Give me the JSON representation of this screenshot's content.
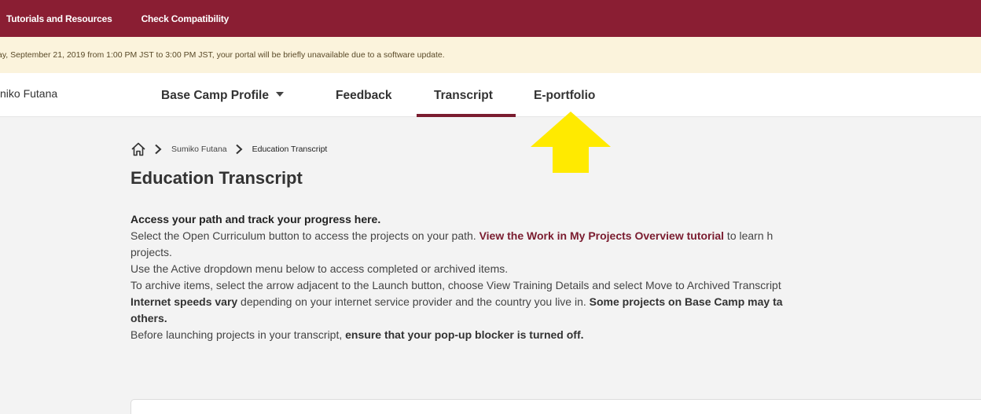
{
  "topbar": {
    "links": [
      "Tutorials and Resources",
      "Check Compatibility"
    ],
    "bg_color": "#8a1e33"
  },
  "banner": {
    "text": "ay, September 21, 2019 from 1:00 PM JST to 3:00 PM JST, your portal will be briefly unavailable due to a software update."
  },
  "navbar": {
    "username": "niko Futana",
    "tabs": [
      "Base Camp Profile",
      "Feedback",
      "Transcript",
      "E-portfolio"
    ],
    "active_tab": "Transcript"
  },
  "annotation": {
    "arrow_color": "#ffea00",
    "arrow_direction": "up"
  },
  "breadcrumb": {
    "items": [
      "Sumiko Futana",
      "Education Transcript"
    ]
  },
  "page": {
    "title": "Education Transcript"
  },
  "content": {
    "lead": "Access your path and track your progress here.",
    "line1_pre": "Select the Open Curriculum button to access the projects on your path. ",
    "line1_link": "View the Work in My Projects Overview tutorial",
    "line1_post": " to learn h",
    "line1_wrap": "projects.",
    "line2": "Use the Active dropdown menu below to access completed or archived items.",
    "line3": "To archive items, select the arrow adjacent to the Launch button, choose View Training Details and select Move to Archived Transcript",
    "line4_bold1": "Internet speeds vary",
    "line4_mid": " depending on your internet service provider and the country you live in. ",
    "line4_bold2": "Some projects on Base Camp may ta",
    "line4_wrap": "others.",
    "line5_pre": "Before launching projects in your transcript, ",
    "line5_bold": "ensure that your pop-up blocker is turned off."
  }
}
